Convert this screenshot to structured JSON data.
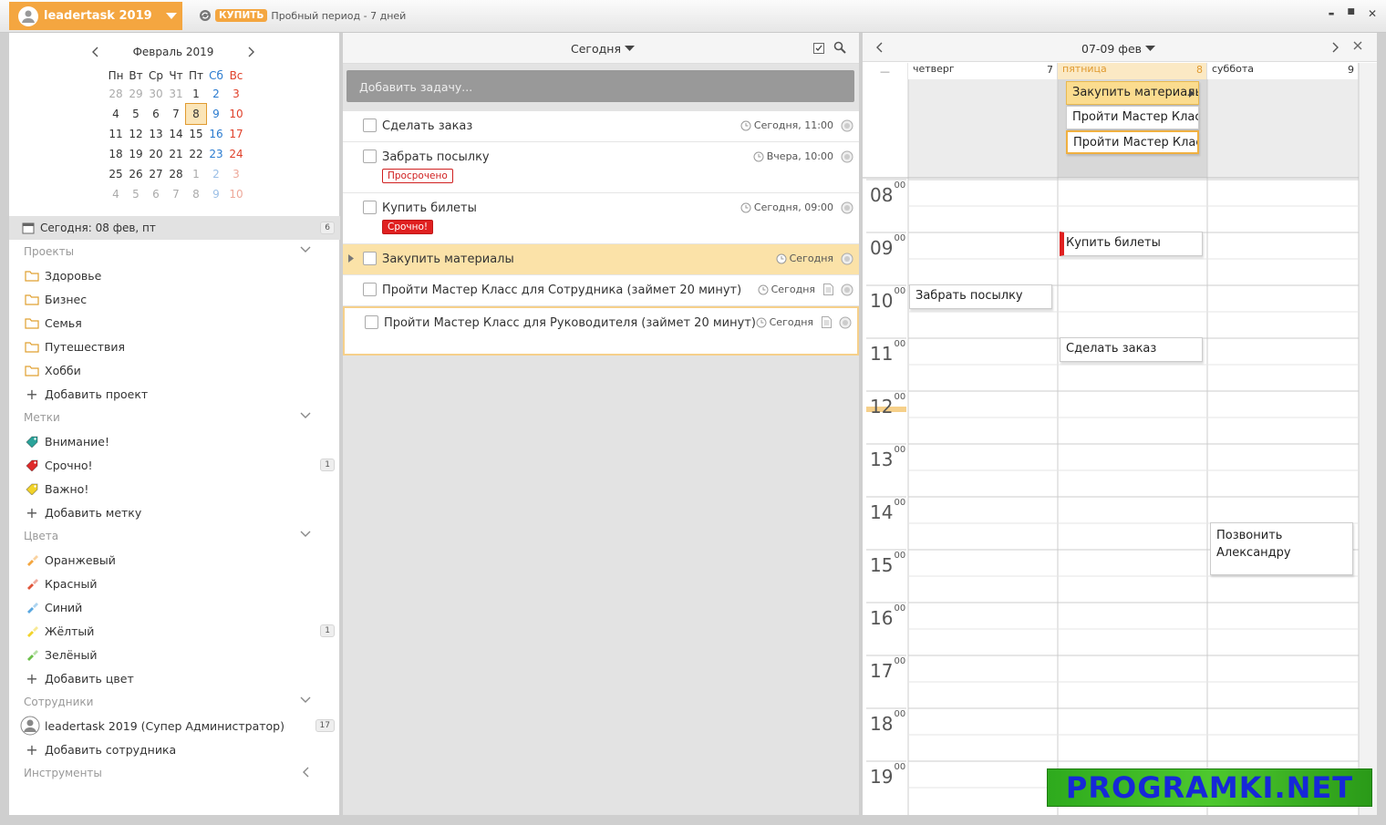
{
  "titlebar": {
    "account_name": "leadertask 2019",
    "buy_label": "КУПИТЬ",
    "trial_text": "Пробный период - 7 дней",
    "minimize": "▬",
    "maximize": "■",
    "close": "✕"
  },
  "calendar": {
    "month": "Февраль 2019",
    "weekdays": [
      "Пн",
      "Вт",
      "Ср",
      "Чт",
      "Пт",
      "Сб",
      "Вс"
    ],
    "weeks": [
      [
        "28",
        "29",
        "30",
        "31",
        "1",
        "2",
        "3"
      ],
      [
        "4",
        "5",
        "6",
        "7",
        "8",
        "9",
        "10"
      ],
      [
        "11",
        "12",
        "13",
        "14",
        "15",
        "16",
        "17"
      ],
      [
        "18",
        "19",
        "20",
        "21",
        "22",
        "23",
        "24"
      ],
      [
        "25",
        "26",
        "27",
        "28",
        "1",
        "2",
        "3"
      ],
      [
        "4",
        "5",
        "6",
        "7",
        "8",
        "9",
        "10"
      ]
    ],
    "selected_day": "8"
  },
  "today": {
    "label": "Сегодня: 08 фев, пт",
    "count": "6"
  },
  "sections": {
    "projects": "Проекты",
    "tags": "Метки",
    "colors": "Цвета",
    "employees": "Сотрудники",
    "tools": "Инструменты"
  },
  "projects": [
    "Здоровье",
    "Бизнес",
    "Семья",
    "Путешествия",
    "Хобби"
  ],
  "add_project": "Добавить проект",
  "tags": [
    {
      "label": "Внимание!",
      "color": "#2aa39a",
      "count": ""
    },
    {
      "label": "Срочно!",
      "color": "#e02a2a",
      "count": "1"
    },
    {
      "label": "Важно!",
      "color": "#f2d32a",
      "count": ""
    }
  ],
  "add_tag": "Добавить метку",
  "colors": [
    {
      "label": "Оранжевый",
      "color": "#f4a640",
      "count": ""
    },
    {
      "label": "Красный",
      "color": "#e0553a",
      "count": ""
    },
    {
      "label": "Синий",
      "color": "#5aa7e0",
      "count": ""
    },
    {
      "label": "Жёлтый",
      "color": "#f2d32a",
      "count": "1"
    },
    {
      "label": "Зелёный",
      "color": "#6cc04a",
      "count": ""
    }
  ],
  "add_color": "Добавить цвет",
  "employee": {
    "label": "leadertask 2019 (Супер Администратор)",
    "count": "17"
  },
  "add_employee": "Добавить сотрудника",
  "middle": {
    "title": "Сегодня",
    "add_placeholder": "Добавить задачу...",
    "tasks": [
      {
        "name": "Сделать заказ",
        "date": "Сегодня, 11:00",
        "tag": ""
      },
      {
        "name": "Забрать посылку",
        "date": "Вчера, 10:00",
        "tag": "Просрочено"
      },
      {
        "name": "Купить билеты",
        "date": "Сегодня, 09:00",
        "tag": "Срочно!"
      },
      {
        "name": "Закупить материалы",
        "date": "Сегодня",
        "tag": ""
      },
      {
        "name": "Пройти Мастер Класс для Сотрудника (займет 20 минут)",
        "date": "Сегодня",
        "tag": ""
      },
      {
        "name": "Пройти Мастер Класс для Руководителя (займет 20 минут)",
        "date": "Сегодня",
        "tag": ""
      }
    ]
  },
  "right": {
    "title": "07-09 фев",
    "days": [
      {
        "name": "четверг",
        "num": "7"
      },
      {
        "name": "пятница",
        "num": "8"
      },
      {
        "name": "суббота",
        "num": "9"
      }
    ],
    "hours": [
      "08",
      "09",
      "10",
      "11",
      "12",
      "13",
      "14",
      "15",
      "16",
      "17",
      "18",
      "19"
    ],
    "hour_min": "00",
    "allday": [
      "Закупить материалы",
      "Пройти Мастер Класс для Сотрудника",
      "Пройти Мастер Класс для Руководителя"
    ],
    "events": {
      "e1": "Купить билеты",
      "e2": "Забрать посылку",
      "e3": "Сделать заказ",
      "e4": "Позвонить Александру"
    }
  },
  "watermark": "PROGRAMKI.NET"
}
